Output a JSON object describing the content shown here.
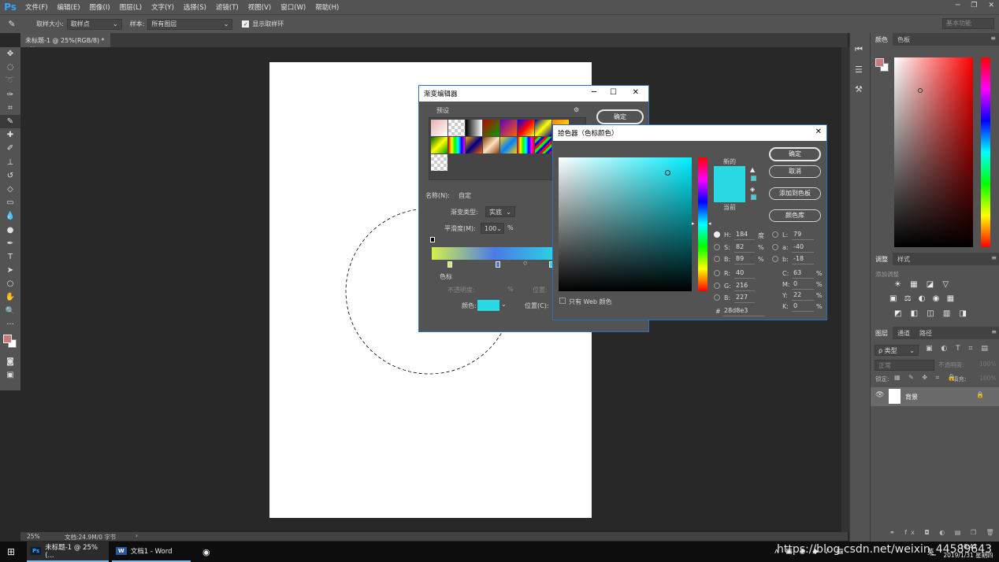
{
  "app": {
    "logo": "Ps",
    "menus": [
      "文件(F)",
      "编辑(E)",
      "图像(I)",
      "图层(L)",
      "文字(Y)",
      "选择(S)",
      "滤镜(T)",
      "视图(V)",
      "窗口(W)",
      "帮助(H)"
    ],
    "workspace": "基本功能"
  },
  "options_bar": {
    "sample_size_label": "取样大小:",
    "sample_size_value": "取样点",
    "sample_label": "样本:",
    "sample_value": "所有图层",
    "show_ring_label": "显示取样环"
  },
  "document": {
    "tab_title": "未标题-1 @ 25%(RGB/8) *",
    "zoom": "25%",
    "doc_info": "文档:24.9M/0 字节"
  },
  "gradient_editor": {
    "title": "渐变编辑器",
    "presets_label": "预设",
    "ok": "确定",
    "name_label": "名称(N):",
    "name_value": "自定",
    "type_label": "渐变类型:",
    "type_value": "实底",
    "smoothness_label": "平滑度(M):",
    "smoothness_value": "100",
    "percent": "%",
    "stops_label": "色标",
    "opacity_label": "不透明度:",
    "position_label": "位置:",
    "color_label": "颜色:",
    "position_c_label": "位置(C):",
    "preset_swatches": [
      "linear-gradient(135deg,#e8b0b0,#fff)",
      "repeating-conic-gradient(#ccc 0 25%,#fff 0 50%)",
      "linear-gradient(90deg,#000,#fff)",
      "linear-gradient(135deg,#c00000,#00a000)",
      "linear-gradient(135deg,#6000c0,#ff6000)",
      "linear-gradient(135deg,#0000ff,#ff0000,#ffff00)",
      "linear-gradient(135deg,#0000a0,#ffff00,#0000a0)",
      "linear-gradient(135deg,#ff8000,#ffff00)",
      "linear-gradient(135deg,#006000,#ffff00,#00a000)",
      "linear-gradient(90deg,#ff0000,#ffff00,#00ff00,#00ffff,#0000ff,#ff00ff)",
      "linear-gradient(135deg,#ffa000,#000080,#ff6000)",
      "linear-gradient(135deg,#804000,#ffe0c0,#804000)",
      "linear-gradient(135deg,#ffd000,#0080ff,#ffd000)",
      "linear-gradient(90deg,#f00,#ff0,#0f0,#0ff,#00f,#f0f,#f00)",
      "repeating-linear-gradient(135deg,#f00 0 3px,#0f0 3px 6px,#00f 6px 9px)",
      "repeating-conic-gradient(#e0b0b0 0 25%,#fff 0 50%)",
      "repeating-conic-gradient(#ccc 0 25%,#fff 0 50%)"
    ]
  },
  "color_picker": {
    "title": "拾色器（色标颜色）",
    "ok": "确定",
    "cancel": "取消",
    "add_to_swatches": "添加到色板",
    "color_libraries": "颜色库",
    "new_label": "新的",
    "current_label": "当前",
    "only_web": "只有 Web 颜色",
    "hsb": [
      {
        "label": "H:",
        "value": "184",
        "unit": "度"
      },
      {
        "label": "S:",
        "value": "82",
        "unit": "%"
      },
      {
        "label": "B:",
        "value": "89",
        "unit": "%"
      }
    ],
    "rgb": [
      {
        "label": "R:",
        "value": "40"
      },
      {
        "label": "G:",
        "value": "216"
      },
      {
        "label": "B:",
        "value": "227"
      }
    ],
    "lab": [
      {
        "label": "L:",
        "value": "79"
      },
      {
        "label": "a:",
        "value": "-40"
      },
      {
        "label": "b:",
        "value": "-18"
      }
    ],
    "cmyk": [
      {
        "label": "C:",
        "value": "63",
        "unit": "%"
      },
      {
        "label": "M:",
        "value": "0",
        "unit": "%"
      },
      {
        "label": "Y:",
        "value": "22",
        "unit": "%"
      },
      {
        "label": "K:",
        "value": "0",
        "unit": "%"
      }
    ],
    "hex_label": "#",
    "hex": "28d8e3"
  },
  "panels": {
    "color_tabs": [
      "颜色",
      "色板"
    ],
    "adjust_tabs": [
      "调整",
      "样式"
    ],
    "adjust_hint": "添加调整",
    "layer_tabs": [
      "图层",
      "通道",
      "路径"
    ],
    "layer_kind": "ρ 类型",
    "blend_mode": "正常",
    "opacity_label": "不透明度:",
    "opacity_value": "100%",
    "lock_label": "锁定:",
    "fill_label": "填充:",
    "fill_value": "100%",
    "layer_name": "背景"
  },
  "taskbar": {
    "ps_task": "未标题-1 @ 25%(...",
    "word_task": "文档1 - Word",
    "ime": "英",
    "time": "10:43",
    "date": "2019/1/31 星期四",
    "watermark": "https://blog.csdn.net/weixin_44589643"
  },
  "colors": {
    "foreground": "#c97a7a",
    "background": "#ffffff",
    "picked": "#28d8e3",
    "ps_blue": "#31a8ff"
  }
}
